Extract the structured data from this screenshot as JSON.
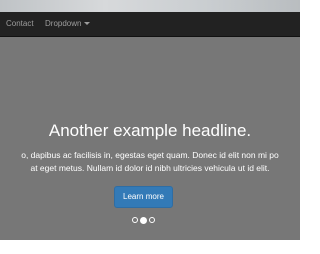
{
  "navbar": {
    "items": [
      {
        "label": "Contact"
      },
      {
        "label": "Dropdown"
      }
    ]
  },
  "carousel": {
    "headline": "Another example headline.",
    "body_lines": [
      "o, dapibus ac facilisis in, egestas eget quam. Donec id elit non mi po",
      "at eget metus. Nullam id dolor id nibh ultricies vehicula ut id elit."
    ],
    "button_label": "Learn more",
    "slide_count": 3,
    "active_slide": 2
  },
  "colors": {
    "navbar_bg": "#222222",
    "carousel_bg": "#777777",
    "button_bg": "#337ab7"
  }
}
